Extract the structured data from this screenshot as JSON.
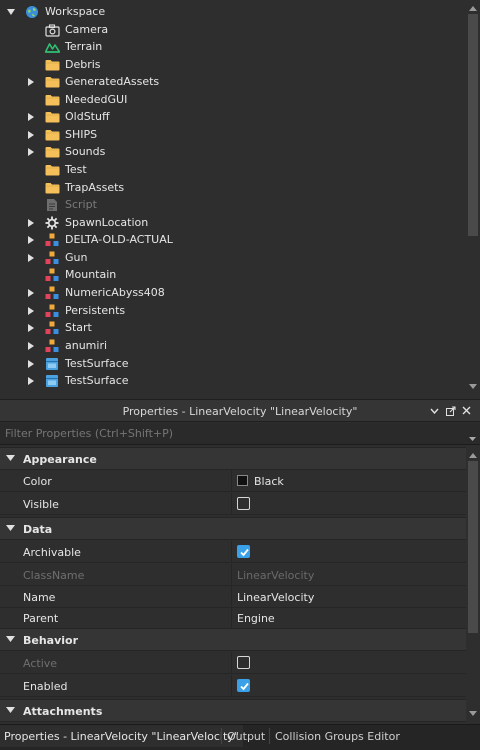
{
  "explorer": {
    "items": [
      {
        "label": "Workspace",
        "icon": "workspace-globe-icon",
        "expanded": true,
        "dim": false
      },
      {
        "label": "Camera",
        "icon": "camera-icon",
        "dim": false
      },
      {
        "label": "Terrain",
        "icon": "terrain-icon",
        "dim": false
      },
      {
        "label": "Debris",
        "icon": "folder-icon",
        "dim": false
      },
      {
        "label": "GeneratedAssets",
        "icon": "folder-icon",
        "dim": false
      },
      {
        "label": "NeededGUI",
        "icon": "folder-icon",
        "dim": false
      },
      {
        "label": "OldStuff",
        "icon": "folder-icon",
        "dim": false
      },
      {
        "label": "SHIPS",
        "icon": "folder-icon",
        "dim": false
      },
      {
        "label": "Sounds",
        "icon": "folder-icon",
        "dim": false
      },
      {
        "label": "Test",
        "icon": "folder-icon",
        "dim": false
      },
      {
        "label": "TrapAssets",
        "icon": "folder-icon",
        "dim": false
      },
      {
        "label": "Script",
        "icon": "script-icon",
        "dim": true
      },
      {
        "label": "SpawnLocation",
        "icon": "spawn-gear-icon",
        "dim": false
      },
      {
        "label": "DELTA-OLD-ACTUAL",
        "icon": "model-icon",
        "dim": false
      },
      {
        "label": "Gun",
        "icon": "model-icon",
        "dim": false
      },
      {
        "label": "Mountain",
        "icon": "model-icon",
        "dim": false
      },
      {
        "label": "NumericAbyss408",
        "icon": "model-icon",
        "dim": false
      },
      {
        "label": "Persistents",
        "icon": "model-icon",
        "dim": false
      },
      {
        "label": "Start",
        "icon": "model-icon",
        "dim": false
      },
      {
        "label": "anumiri",
        "icon": "model-icon",
        "dim": false
      },
      {
        "label": "TestSurface",
        "icon": "surface-icon",
        "dim": false
      },
      {
        "label": "TestSurface",
        "icon": "surface-icon",
        "dim": false
      }
    ]
  },
  "properties": {
    "title": "Properties - LinearVelocity \"LinearVelocity\"",
    "filter_placeholder": "Filter Properties (Ctrl+Shift+P)",
    "categories": {
      "appearance": "Appearance",
      "data": "Data",
      "behavior": "Behavior",
      "attachments": "Attachments"
    },
    "rows": {
      "color_name": "Color",
      "color_value": "Black",
      "visible_name": "Visible",
      "visible_checked": false,
      "archivable_name": "Archivable",
      "archivable_checked": true,
      "classname_name": "ClassName",
      "classname_value": "LinearVelocity",
      "name_name": "Name",
      "name_value": "LinearVelocity",
      "parent_name": "Parent",
      "parent_value": "Engine",
      "active_name": "Active",
      "active_checked": false,
      "enabled_name": "Enabled",
      "enabled_checked": true
    }
  },
  "tabs": {
    "properties": "Properties - LinearVelocity \"LinearVelocity\"",
    "output": "Output",
    "collision": "Collision Groups Editor"
  },
  "colors": {
    "background": "#2e2e2e",
    "accent_checkbox": "#3aa0e8",
    "folder": "#f5c05a",
    "terrain": "#2fbf71",
    "surface": "#4aa3e0"
  }
}
